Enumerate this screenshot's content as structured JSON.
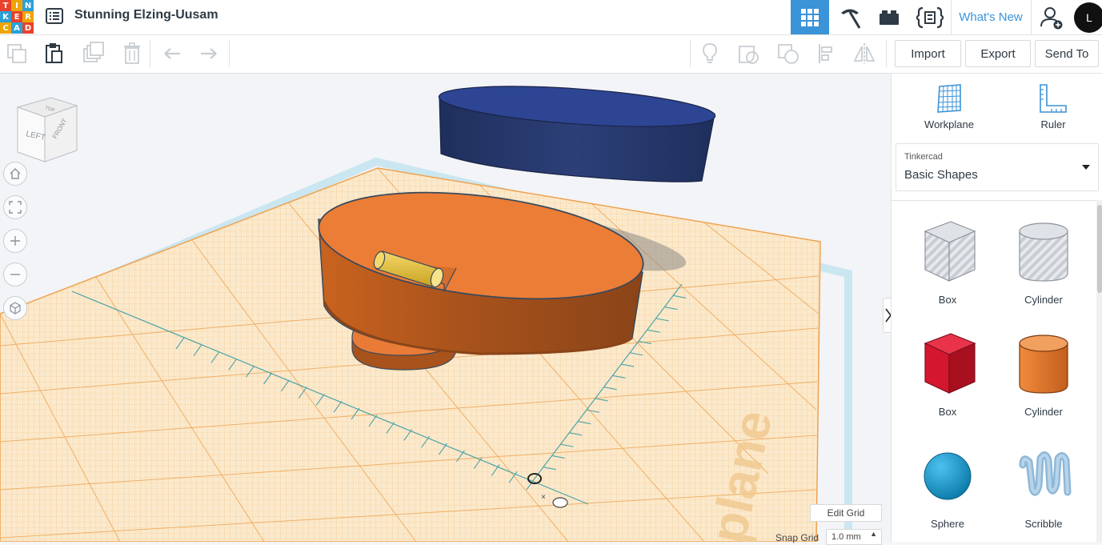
{
  "app": {
    "logo_letters": [
      "T",
      "I",
      "N",
      "K",
      "E",
      "R",
      "C",
      "A",
      "D"
    ],
    "logo_colors": [
      "#e8412c",
      "#f0a400",
      "#2ba0d8",
      "#2ba0d8",
      "#e8412c",
      "#f0a400",
      "#f0a400",
      "#2ba0d8",
      "#e8412c"
    ],
    "design_title": "Stunning Elzing-Uusam",
    "avatar_text": "L",
    "whats_new_label": "What's New"
  },
  "toolbar": {
    "import_label": "Import",
    "export_label": "Export",
    "send_to_label": "Send To"
  },
  "viewcube": {
    "left": "LEFT",
    "front": "FRONT",
    "top": "TOP"
  },
  "workplane": {
    "watermark": "plane"
  },
  "grid_controls": {
    "edit_grid_label": "Edit Grid",
    "snap_grid_label": "Snap Grid",
    "snap_value": "1.0 mm"
  },
  "panel": {
    "workplane_label": "Workplane",
    "ruler_label": "Ruler",
    "library_source": "Tinkercad",
    "library_name": "Basic Shapes",
    "shapes": [
      {
        "label": "Box",
        "icon": "box-striped-icon"
      },
      {
        "label": "Cylinder",
        "icon": "cylinder-striped-icon"
      },
      {
        "label": "Box",
        "icon": "box-red-icon"
      },
      {
        "label": "Cylinder",
        "icon": "cylinder-orange-icon"
      },
      {
        "label": "Sphere",
        "icon": "sphere-blue-icon"
      },
      {
        "label": "Scribble",
        "icon": "scribble-icon"
      }
    ]
  },
  "colors": {
    "accent_blue": "#3b93d8",
    "grid_orange": "#f1b45c",
    "shape_orange": "#e97b36",
    "shape_navy": "#27386b",
    "handle_yellow": "#e8c23b"
  }
}
